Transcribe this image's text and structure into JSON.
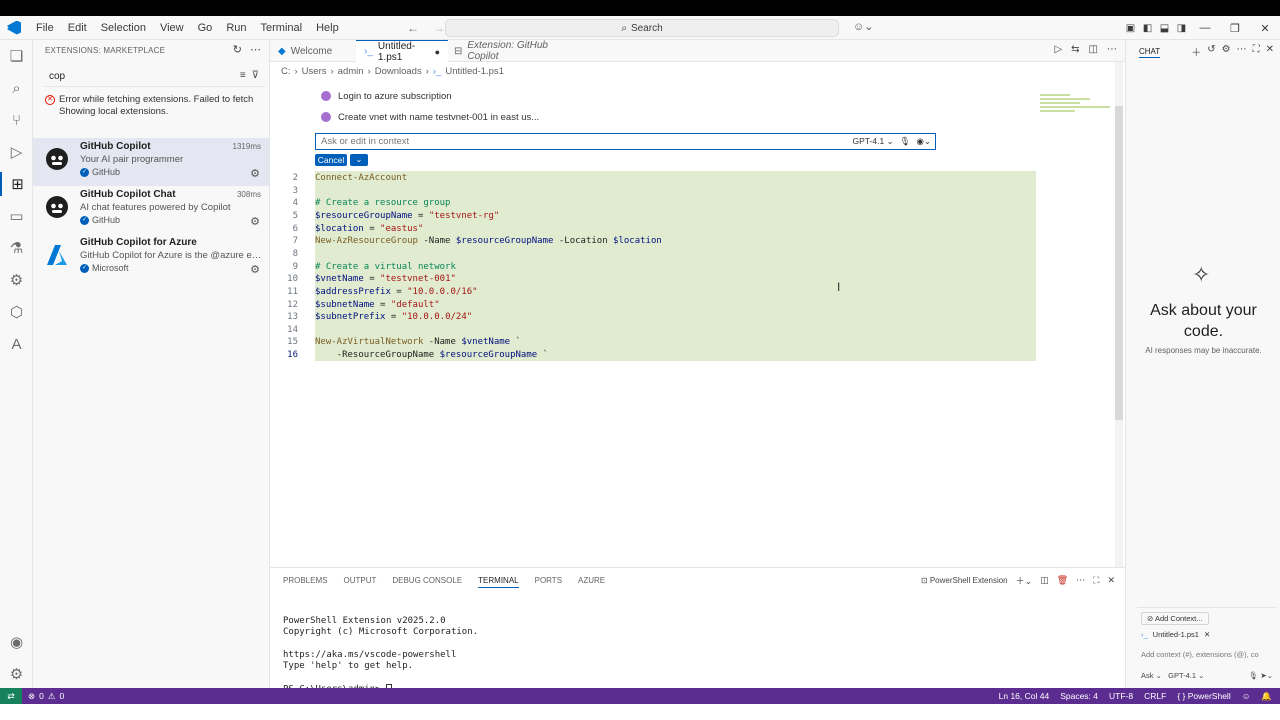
{
  "menu": [
    "File",
    "Edit",
    "Selection",
    "View",
    "Go",
    "Run",
    "Terminal",
    "Help"
  ],
  "search": {
    "label": "Search"
  },
  "sidebar": {
    "title": "EXTENSIONS: MARKETPLACE",
    "search_value": "cop",
    "error": "Error while fetching extensions. Failed to fetch Showing local extensions.",
    "extensions": [
      {
        "name": "GitHub Copilot",
        "desc": "Your AI pair programmer",
        "publisher": "GitHub",
        "time": "1319ms"
      },
      {
        "name": "GitHub Copilot Chat",
        "desc": "AI chat features powered by Copilot",
        "publisher": "GitHub",
        "time": "308ms"
      },
      {
        "name": "GitHub Copilot for Azure",
        "desc": "GitHub Copilot for Azure is the @azure extens...",
        "publisher": "Microsoft",
        "time": ""
      }
    ]
  },
  "tabs": [
    {
      "label": "Welcome"
    },
    {
      "label": "Untitled-1.ps1"
    },
    {
      "label": "Extension: GitHub Copilot"
    }
  ],
  "breadcrumb": [
    "C:",
    "Users",
    "admin",
    "Downloads",
    "Untitled-1.ps1"
  ],
  "inline_chat": {
    "items": [
      "Login to azure subscription",
      "Create vnet with name testvnet-001 in east us..."
    ],
    "placeholder": "Ask or edit in context",
    "model": "GPT-4.1",
    "cancel": "Cancel"
  },
  "code_lines": [
    {
      "n": "2",
      "parts": [
        [
          "c-cmd",
          "Connect-AzAccount"
        ]
      ]
    },
    {
      "n": "3",
      "parts": []
    },
    {
      "n": "4",
      "parts": [
        [
          "c-cmt",
          "# Create a resource group"
        ]
      ]
    },
    {
      "n": "5",
      "parts": [
        [
          "c-var",
          "$resourceGroupName"
        ],
        [
          "c-param",
          " = "
        ],
        [
          "c-str",
          "\"testvnet-rg\""
        ]
      ]
    },
    {
      "n": "6",
      "parts": [
        [
          "c-var",
          "$location"
        ],
        [
          "c-param",
          " = "
        ],
        [
          "c-str",
          "\"eastus\""
        ]
      ]
    },
    {
      "n": "7",
      "parts": [
        [
          "c-cmd",
          "New-AzResourceGroup"
        ],
        [
          "c-param",
          " -Name "
        ],
        [
          "c-var",
          "$resourceGroupName"
        ],
        [
          "c-param",
          " -Location "
        ],
        [
          "c-var",
          "$location"
        ]
      ]
    },
    {
      "n": "8",
      "parts": []
    },
    {
      "n": "9",
      "parts": [
        [
          "c-cmt",
          "# Create a virtual network"
        ]
      ]
    },
    {
      "n": "10",
      "parts": [
        [
          "c-var",
          "$vnetName"
        ],
        [
          "c-param",
          " = "
        ],
        [
          "c-str",
          "\"testvnet-001\""
        ]
      ]
    },
    {
      "n": "11",
      "parts": [
        [
          "c-var",
          "$addressPrefix"
        ],
        [
          "c-param",
          " = "
        ],
        [
          "c-str",
          "\"10.0.0.0/16\""
        ]
      ]
    },
    {
      "n": "12",
      "parts": [
        [
          "c-var",
          "$subnetName"
        ],
        [
          "c-param",
          " = "
        ],
        [
          "c-str",
          "\"default\""
        ]
      ]
    },
    {
      "n": "13",
      "parts": [
        [
          "c-var",
          "$subnetPrefix"
        ],
        [
          "c-param",
          " = "
        ],
        [
          "c-str",
          "\"10.0.0.0/24\""
        ]
      ]
    },
    {
      "n": "14",
      "parts": []
    },
    {
      "n": "15",
      "parts": [
        [
          "c-cmd",
          "New-AzVirtualNetwork"
        ],
        [
          "c-param",
          " -Name "
        ],
        [
          "c-var",
          "$vnetName"
        ],
        [
          "c-param",
          " `"
        ]
      ]
    },
    {
      "n": "16",
      "parts": [
        [
          "c-param",
          "    -ResourceGroupName "
        ],
        [
          "c-var",
          "$resourceGroupName"
        ],
        [
          "c-param",
          " `"
        ]
      ]
    }
  ],
  "panel": {
    "tabs": [
      "PROBLEMS",
      "OUTPUT",
      "DEBUG CONSOLE",
      "TERMINAL",
      "PORTS",
      "AZURE"
    ],
    "active_tab": "TERMINAL",
    "terminal_name": "PowerShell Extension",
    "lines": [
      "PowerShell Extension v2025.2.0",
      "Copyright (c) Microsoft Corporation.",
      "",
      "https://aka.ms/vscode-powershell",
      "Type 'help' to get help.",
      "",
      "PS C:\\Users\\admin> "
    ]
  },
  "chat": {
    "header": "CHAT",
    "title": "Ask about your code.",
    "subtitle": "AI responses may be inaccurate.",
    "add_context": "Add Context...",
    "file": "Untitled-1.ps1",
    "placeholder": "Add context (#), extensions (@), co",
    "mode": "Ask",
    "model": "GPT-4.1"
  },
  "status": {
    "errors": "0",
    "warnings": "0",
    "position": "Ln 16, Col 44",
    "spaces": "Spaces: 4",
    "encoding": "UTF-8",
    "eol": "CRLF",
    "language": "PowerShell"
  }
}
